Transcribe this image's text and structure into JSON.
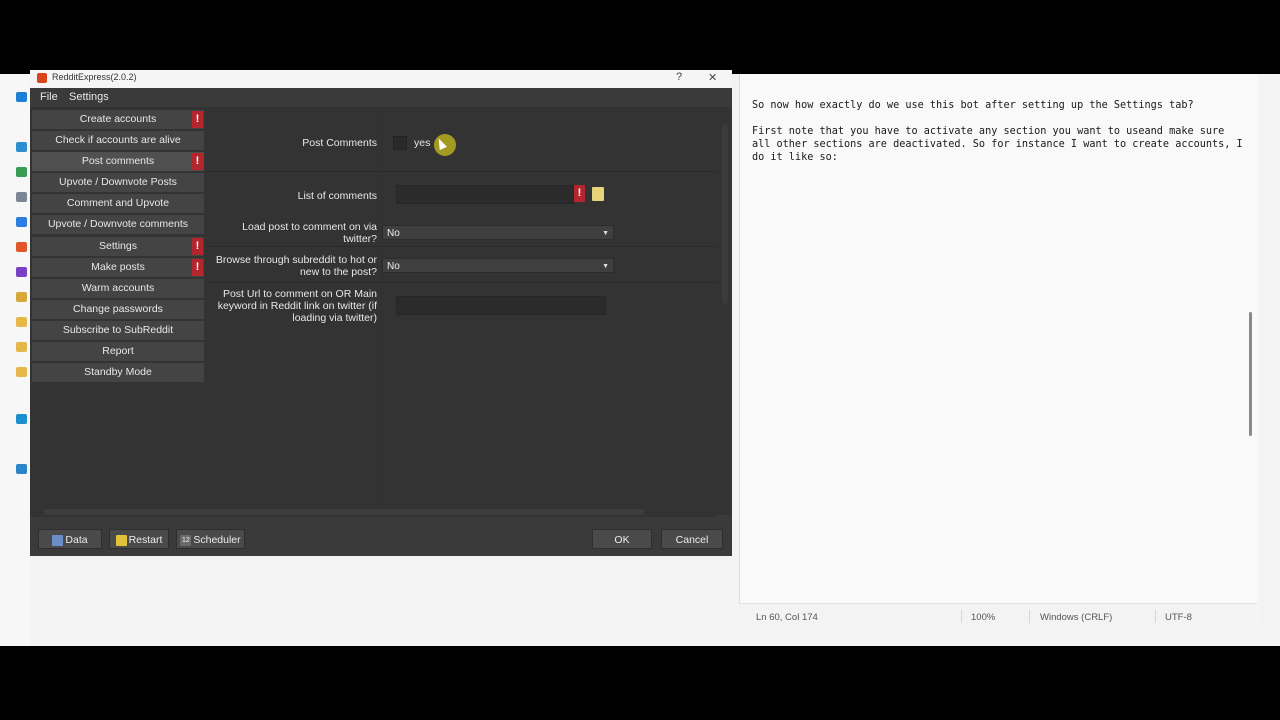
{
  "window": {
    "title": "RedditExpress(2.0.2)",
    "help_label": "?",
    "close_label": "✕"
  },
  "menu": {
    "file": "File",
    "settings": "Settings"
  },
  "nav": [
    {
      "label": "Create accounts",
      "warn": true
    },
    {
      "label": "Check if accounts are alive",
      "warn": false
    },
    {
      "label": "Post comments",
      "warn": true,
      "active": true
    },
    {
      "label": "Upvote / Downvote Posts",
      "warn": false
    },
    {
      "label": "Comment and Upvote",
      "warn": false
    },
    {
      "label": "Upvote / Downvote comments",
      "warn": false
    },
    {
      "label": "Settings",
      "warn": true
    },
    {
      "label": "Make posts",
      "warn": true
    },
    {
      "label": "Warm accounts",
      "warn": false
    },
    {
      "label": "Change passwords",
      "warn": false
    },
    {
      "label": "Subscribe to SubReddit",
      "warn": false
    },
    {
      "label": "Report",
      "warn": false
    },
    {
      "label": "Standby Mode",
      "warn": false
    }
  ],
  "warn_glyph": "!",
  "form": {
    "post_comments_label": "Post Comments",
    "post_comments_checkbox_label": "yes",
    "list_comments_label": "List of comments",
    "load_post_label": "Load post to comment  on via twitter?",
    "load_post_value": "No",
    "browse_label": "Browse through subreddit to hot or new to the post?",
    "browse_value": "No",
    "post_url_label": "Post Url to comment on OR Main keyword in Reddit link on twitter (if loading via twitter)"
  },
  "footer": {
    "data": "Data",
    "restart": "Restart",
    "scheduler": "Scheduler",
    "scheduler_icon_text": "12",
    "ok": "OK",
    "cancel": "Cancel"
  },
  "notepad": {
    "text": "So now how exactly do we use this bot after setting up the Settings tab?\n\nFirst note that you have to activate any section you want to useand make sure all other sections are deactivated. So for instance I want to create accounts, I do it like so:",
    "status": {
      "position": "Ln 60, Col 174",
      "zoom": "100%",
      "line_ending": "Windows (CRLF)",
      "encoding": "UTF-8"
    }
  },
  "colors": {
    "warn": "#b3262d",
    "accent_cursor": "#c8be1e"
  },
  "icons": [
    "app-logo-icon",
    "database-icon",
    "restart-icon",
    "calendar-icon",
    "folder-icon",
    "warning-icon",
    "chevron-down-icon"
  ]
}
